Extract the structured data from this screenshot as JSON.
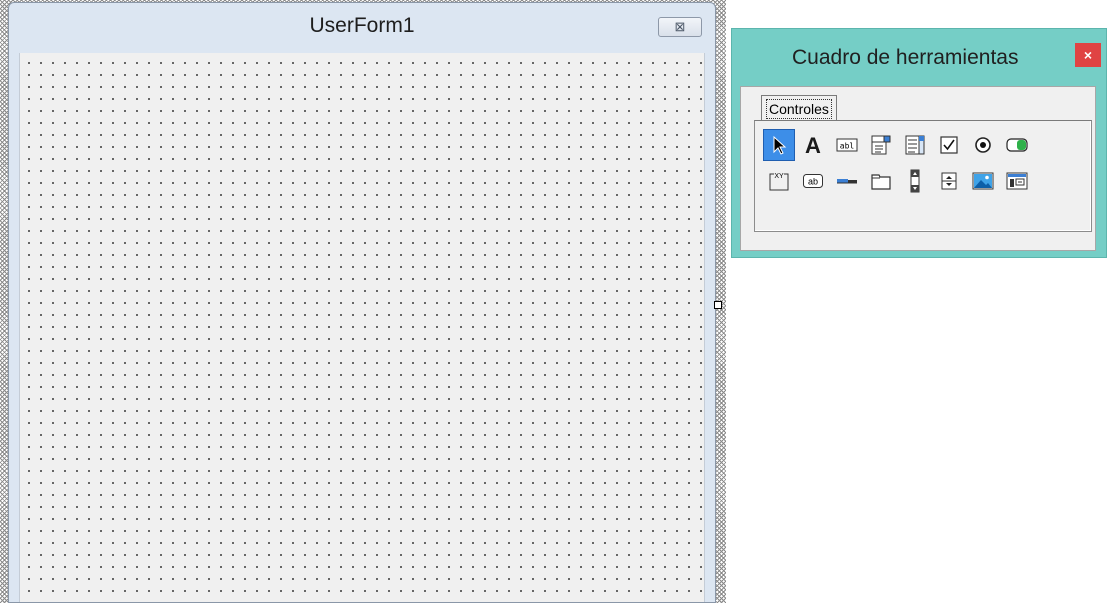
{
  "userform": {
    "title": "UserForm1",
    "close_glyph": "⊠",
    "close_icon": "close-icon"
  },
  "toolbox": {
    "title": "Cuadro de herramientas",
    "close_glyph": "×",
    "tab_label": "Controles",
    "selected_tool": "select-objects",
    "tools_row1": [
      {
        "id": "select-objects",
        "icon": "pointer-icon"
      },
      {
        "id": "label",
        "icon": "label-icon"
      },
      {
        "id": "textbox",
        "icon": "textbox-icon"
      },
      {
        "id": "combobox",
        "icon": "combobox-icon"
      },
      {
        "id": "listbox",
        "icon": "listbox-icon"
      },
      {
        "id": "checkbox",
        "icon": "checkbox-icon"
      },
      {
        "id": "optionbutton",
        "icon": "optionbutton-icon"
      },
      {
        "id": "togglebutton",
        "icon": "togglebutton-icon"
      }
    ],
    "tools_row2": [
      {
        "id": "frame",
        "icon": "frame-icon",
        "text": "XY"
      },
      {
        "id": "commandbutton",
        "icon": "commandbutton-icon",
        "text": "ab"
      },
      {
        "id": "tabstrip",
        "icon": "tabstrip-icon"
      },
      {
        "id": "multipage",
        "icon": "multipage-icon"
      },
      {
        "id": "scrollbar",
        "icon": "scrollbar-icon"
      },
      {
        "id": "spinbutton",
        "icon": "spinbutton-icon"
      },
      {
        "id": "image",
        "icon": "image-icon"
      },
      {
        "id": "refedit",
        "icon": "refedit-icon"
      }
    ]
  },
  "colors": {
    "toolbox_frame": "#75cec6",
    "close_red": "#e04343",
    "selected_tool": "#3d8ee8",
    "form_client": "#f0f0f0"
  }
}
